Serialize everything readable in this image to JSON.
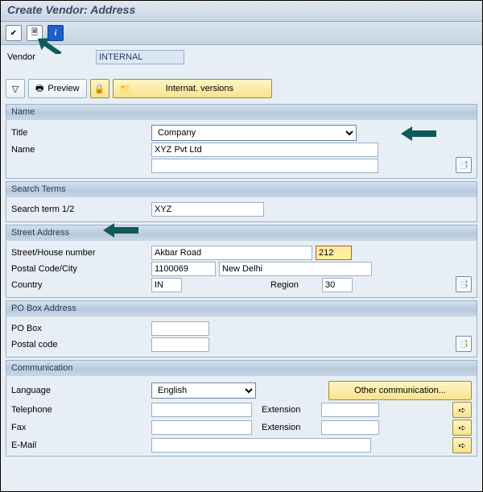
{
  "window": {
    "title": "Create Vendor: Address"
  },
  "sysbar": {
    "i1_name": "check-icon",
    "i2_name": "document-icon",
    "i3_name": "info-icon",
    "i3_label": "i"
  },
  "header": {
    "vendor_label": "Vendor",
    "vendor_value": "INTERNAL"
  },
  "toolbar": {
    "check_name": "mark-icon",
    "preview_label": "Preview",
    "lock_name": "lock-icon",
    "folder_name": "folder-icon",
    "intl_label": "Internat. versions"
  },
  "name_panel": {
    "heading": "Name",
    "title_lbl": "Title",
    "title_value": "Company",
    "name_lbl": "Name",
    "name_value": "XYZ Pvt Ltd",
    "extra_value": ""
  },
  "search_panel": {
    "heading": "Search Terms",
    "s1_lbl": "Search term 1/2",
    "s1_value": "XYZ"
  },
  "street_panel": {
    "heading": "Street Address",
    "street_lbl": "Street/House number",
    "street_value": "Akbar Road",
    "house_value": "212",
    "postal_lbl": "Postal Code/City",
    "postal_value": "1100069",
    "city_value": "New Delhi",
    "country_lbl": "Country",
    "country_value": "IN",
    "region_lbl": "Region",
    "region_value": "30"
  },
  "pobox_panel": {
    "heading": "PO Box Address",
    "pobox_lbl": "PO Box",
    "pobox_value": "",
    "pcode_lbl": "Postal code",
    "pcode_value": ""
  },
  "comm_panel": {
    "heading": "Communication",
    "lang_lbl": "Language",
    "lang_value": "English",
    "other_btn": "Other communication...",
    "tel_lbl": "Telephone",
    "ext_lbl": "Extension",
    "fax_lbl": "Fax",
    "email_lbl": "E-Mail"
  }
}
